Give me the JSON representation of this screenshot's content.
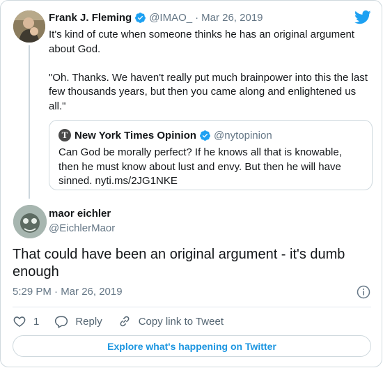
{
  "parent_tweet": {
    "author_name": "Frank J. Fleming",
    "handle": "@IMAO_",
    "separator": "·",
    "date": "Mar 26, 2019",
    "text": "It's kind of cute when someone thinks he has an original argument about God.\n\n\"Oh. Thanks. We haven't really put much brainpower into this the last few thousands years, but then you came along and enlightened us all.\"",
    "verified": true
  },
  "quoted_tweet": {
    "icon_letter": "T",
    "author_name": "New York Times Opinion",
    "handle": "@nytopinion",
    "text": "Can God be morally perfect? If he knows all that is knowable, then he must know about lust and envy. But then he will have sinned. nyti.ms/2JG1NKE",
    "verified": true
  },
  "main_tweet": {
    "author_name": "maor eichler",
    "handle": "@EichlerMaor",
    "text": "That could have been an original argument - it's dumb enough",
    "timestamp": "5:29 PM · Mar 26, 2019"
  },
  "actions": {
    "like_count": "1",
    "reply_label": "Reply",
    "copy_link_label": "Copy link to Tweet"
  },
  "explore_label": "Explore what's happening on Twitter",
  "colors": {
    "twitter_blue": "#1da1f2",
    "link_blue": "#1b95e0",
    "secondary_text": "#657786",
    "border": "#cfd9de"
  },
  "icons": [
    "twitter-bird-icon",
    "verified-badge-icon",
    "info-icon",
    "heart-icon",
    "reply-icon",
    "link-icon"
  ]
}
